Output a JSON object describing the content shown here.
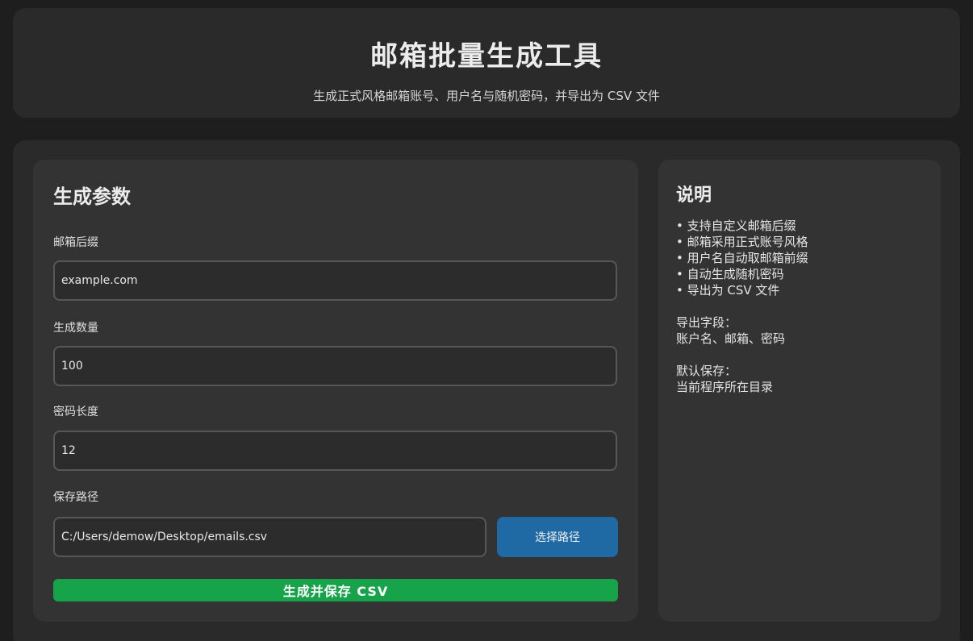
{
  "header": {
    "title": "邮箱批量生成工具",
    "subtitle": "生成正式风格邮箱账号、用户名与随机密码，并导出为 CSV 文件"
  },
  "params": {
    "title": "生成参数",
    "suffix_label": "邮箱后缀",
    "suffix_value": "example.com",
    "count_label": "生成数量",
    "count_value": "100",
    "length_label": "密码长度",
    "length_value": "12",
    "path_label": "保存路径",
    "path_value": "C:/Users/demow/Desktop/emails.csv",
    "choose_path_button": "选择路径",
    "generate_button": "生成并保存 CSV"
  },
  "info": {
    "title": "说明",
    "bullets": [
      "• 支持自定义邮箱后缀",
      "• 邮箱采用正式账号风格",
      "• 用户名自动取邮箱前缀",
      "• 自动生成随机密码",
      "• 导出为 CSV 文件"
    ],
    "fields_heading": "导出字段：",
    "fields_value": "账户名、邮箱、密码",
    "save_heading": "默认保存：",
    "save_value": "当前程序所在目录"
  },
  "colors": {
    "background": "#1e1e1e",
    "panel": "#2a2a2a",
    "card": "#333333",
    "primary_button": "#1f6aa5",
    "success_button": "#16a34a"
  }
}
